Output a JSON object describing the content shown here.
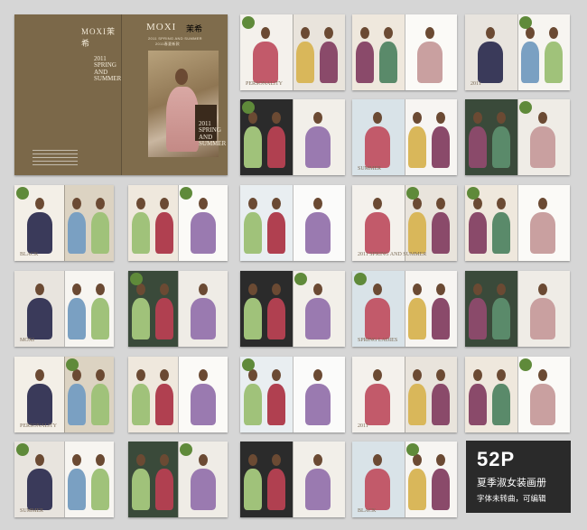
{
  "cover": {
    "brand_en": "MOXI",
    "brand_cn": "茉希",
    "brand_small_left": "MOXI茉希",
    "season_line": "2011 SPRING AND SUMMER",
    "season_cn": "2011春夏新款",
    "big_left": "2011\nSPRING\nAND\nSUMMER",
    "big_right": "2011\nSPRING\nAND\nSUMMER"
  },
  "spread_texts": {
    "personality": "PERSONALITY",
    "spring_summer": "2011 SPRING AND SUMMER",
    "year": "2011",
    "moxi": "MOXI",
    "summer": "SUMMER",
    "spring_ladies": "SPRING LADIES",
    "black": "BLACK"
  },
  "info_panel": {
    "pages": "52P",
    "title": "夏季淑女装画册",
    "note": "字体未转曲，可编辑"
  }
}
